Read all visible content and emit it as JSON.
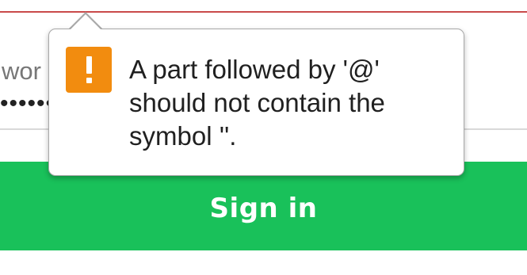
{
  "form": {
    "password_label": "wor",
    "password_value": "••••••",
    "signin_label": "Sign in"
  },
  "tooltip": {
    "icon": "warning-icon",
    "message": "A part followed by '@' should not contain the symbol ''."
  },
  "colors": {
    "button_green": "#19c15a",
    "warning_orange": "#f28c0f",
    "error_underline": "#c94b4b"
  }
}
